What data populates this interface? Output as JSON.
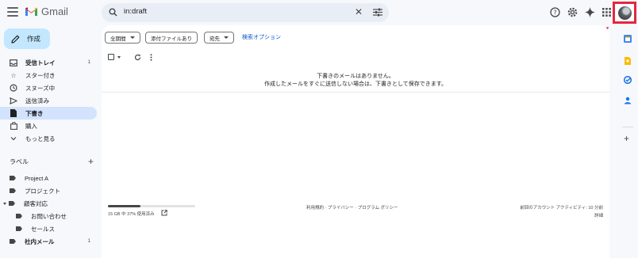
{
  "app": {
    "name": "Gmail"
  },
  "search": {
    "query": "in:draft"
  },
  "compose": {
    "label": "作成"
  },
  "nav": [
    {
      "label": "受信トレイ",
      "count": "1",
      "icon": "inbox-icon",
      "bold": true
    },
    {
      "label": "スター付き",
      "count": "",
      "icon": "star-icon"
    },
    {
      "label": "スヌーズ中",
      "count": "",
      "icon": "clock-icon"
    },
    {
      "label": "送信済み",
      "count": "",
      "icon": "send-icon"
    },
    {
      "label": "下書き",
      "count": "",
      "icon": "draft-icon",
      "active": true
    },
    {
      "label": "購入",
      "count": "",
      "icon": "shopping-bag-icon"
    },
    {
      "label": "もっと見る",
      "count": "",
      "icon": "chevron-down-icon"
    }
  ],
  "labels_section": {
    "title": "ラベル",
    "items": [
      {
        "label": "Project A",
        "count": "",
        "indent": 0
      },
      {
        "label": "プロジェクト",
        "count": "",
        "indent": 0
      },
      {
        "label": "顧客対応",
        "count": "",
        "indent": 0
      },
      {
        "label": "お問い合わせ",
        "count": "",
        "indent": 1
      },
      {
        "label": "セールス",
        "count": "",
        "indent": 1
      },
      {
        "label": "社内メール",
        "count": "1",
        "indent": 0,
        "bold": true
      }
    ]
  },
  "filters": {
    "period": "全期間",
    "attachment": "添付ファイルあり",
    "to": "宛先",
    "advanced": "検索オプション"
  },
  "empty_state": {
    "line1": "下書きのメールはありません。",
    "line2": "作成したメールをすぐに送信しない場合は、下書きとして保存できます。"
  },
  "footer": {
    "storage": "15 GB 中 37% 使用済み",
    "storage_fraction": 0.37,
    "terms": "利用規約",
    "privacy": "プライバシー",
    "program_policy": "プログラム ポリシー",
    "last_activity": "前回のアカウント アクティビティ: 10 分前",
    "details": "詳細"
  },
  "colors": {
    "accent": "#0b57d0",
    "compose_bg": "#c2e7ff",
    "active_nav": "#d3e3fd",
    "highlight": "#e3283e"
  }
}
